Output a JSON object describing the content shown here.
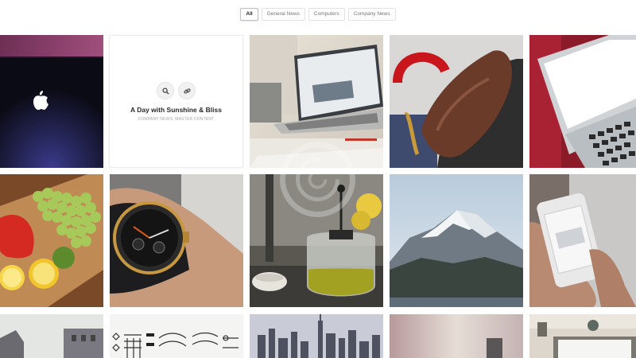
{
  "filters": [
    {
      "label": "All",
      "active": true
    },
    {
      "label": "General News",
      "active": false
    },
    {
      "label": "Computers",
      "active": false
    },
    {
      "label": "Company News",
      "active": false
    }
  ],
  "card": {
    "title": "A Day with Sunshine & Bliss",
    "meta": "COMPANY NEWS, MASTER CONTENT",
    "icons": [
      "search-icon",
      "link-icon"
    ]
  },
  "tiles": [
    "apple-laptop-lid",
    "news-card",
    "laptop-on-desk",
    "leather-glove-steering-wheel",
    "macbook-keyboard-closeup",
    "grapes-pepper-lemon",
    "wristwatch",
    "french-press-tea",
    "snowy-mountain",
    "iphone-in-hand",
    "city-street",
    "icon-sketches",
    "city-skyline",
    "blurred-room",
    "desk-items"
  ]
}
